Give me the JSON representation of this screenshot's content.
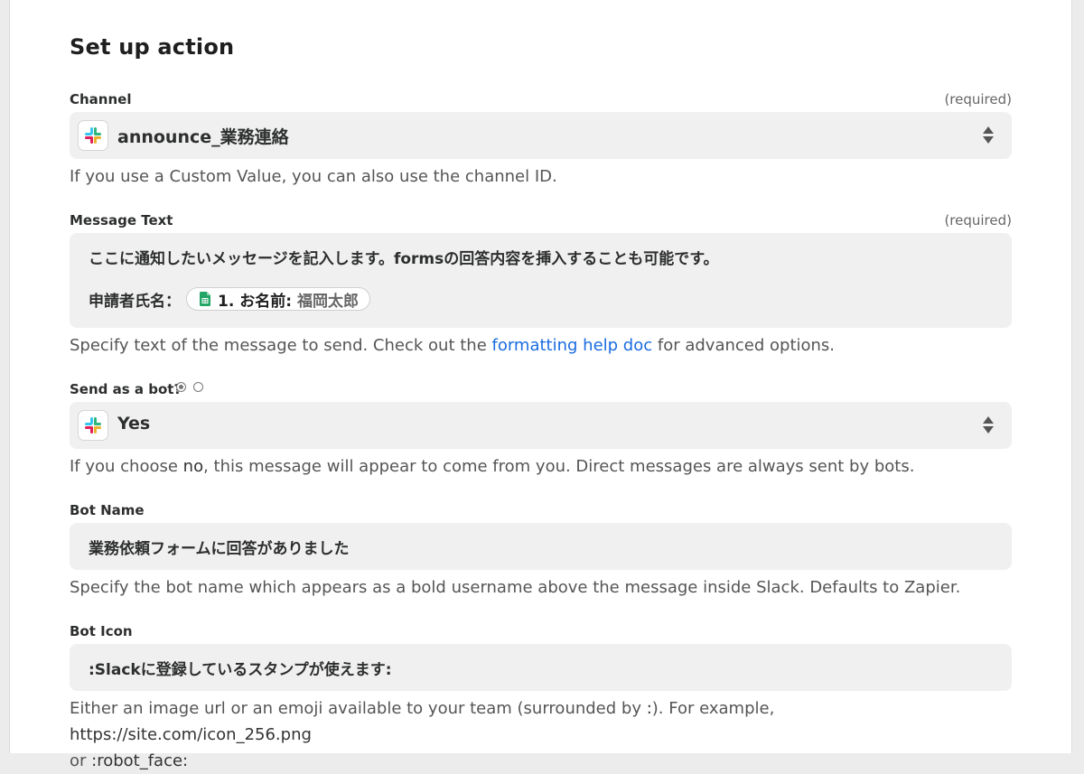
{
  "title": "Set up action",
  "channel": {
    "label": "Channel",
    "required": "(required)",
    "value": "announce_業務連絡",
    "help": "If you use a Custom Value, you can also use the channel ID.",
    "icon": "slack-icon"
  },
  "message": {
    "label": "Message Text",
    "required": "(required)",
    "line1": "ここに通知したいメッセージを記入します。formsの回答内容を挿入することも可能です。",
    "line2_prefix": "申請者氏名：",
    "pill_step": "1. お名前:",
    "pill_value": "福岡太郎",
    "pill_icon": "google-sheets-icon",
    "help_before": "Specify text of the message to send. Check out the ",
    "help_link": "formatting help doc",
    "help_after": " for advanced options."
  },
  "bot": {
    "label": "Send as a bot?",
    "value": "Yes",
    "help_before": "If you choose ",
    "help_mono": "no",
    "help_after": ", this message will appear to come from you. Direct messages are always sent by bots.",
    "icon": "slack-icon"
  },
  "bot_name": {
    "label": "Bot Name",
    "value": "業務依頼フォームに回答がありました",
    "help": "Specify the bot name which appears as a bold username above the message inside Slack. Defaults to Zapier."
  },
  "bot_icon": {
    "label": "Bot Icon",
    "value": ":Slackに登録しているスタンプが使えます:",
    "help_before": "Either an image url or an emoji available to your team (surrounded by ",
    "help_mono1": ":",
    "help_mid": "). For example, ",
    "help_mono2": "https://site.com/icon_256.png",
    "help_or": " or ",
    "help_mono3": ":robot_face:"
  },
  "colors": {
    "link": "#1a6ce0",
    "field_bg": "#f0f0f0",
    "sheets_green": "#23a566"
  }
}
